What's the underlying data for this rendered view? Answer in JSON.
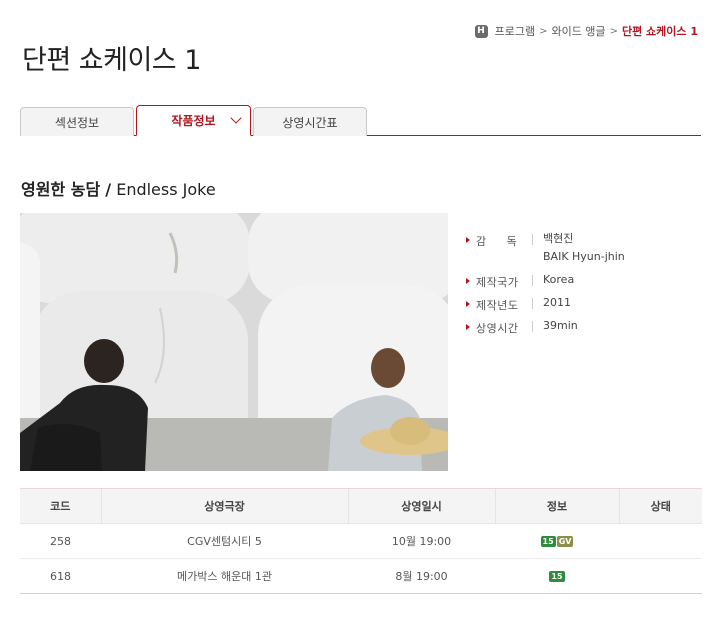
{
  "breadcrumb": {
    "home_icon": "H",
    "items": [
      "프로그램",
      "와이드 앵글",
      "단편 쇼케이스 1"
    ],
    "separator": ">"
  },
  "page_title": "단편 쇼케이스 1",
  "tabs": [
    {
      "label": "섹션정보",
      "active": false
    },
    {
      "label": "작품정보",
      "active": true
    },
    {
      "label": "상영시간표",
      "active": false
    }
  ],
  "film": {
    "title_ko": "영원한 농담",
    "title_sep": "/",
    "title_en": "Endless Joke"
  },
  "info": {
    "director_label": "감     독",
    "director_ko": "백현진",
    "director_en": "BAIK Hyun-jhin",
    "country_label": "제작국가",
    "country": "Korea",
    "year_label": "제작년도",
    "year": "2011",
    "runtime_label": "상영시간",
    "runtime": "39min"
  },
  "schedule": {
    "headers": [
      "코드",
      "상영극장",
      "상영일시",
      "정보",
      "상태"
    ],
    "rows": [
      {
        "code": "258",
        "theater": "CGV센텀시티 5",
        "datetime": "10월 19:00",
        "rating": "15",
        "gv": "GV",
        "status": ""
      },
      {
        "code": "618",
        "theater": "메가박스 해운대 1관",
        "datetime": "8월 19:00",
        "rating": "15",
        "status": ""
      }
    ]
  },
  "colors": {
    "accent": "#b4141e",
    "rating_green": "#2d8d3d",
    "gv_olive": "#8b8f48"
  }
}
